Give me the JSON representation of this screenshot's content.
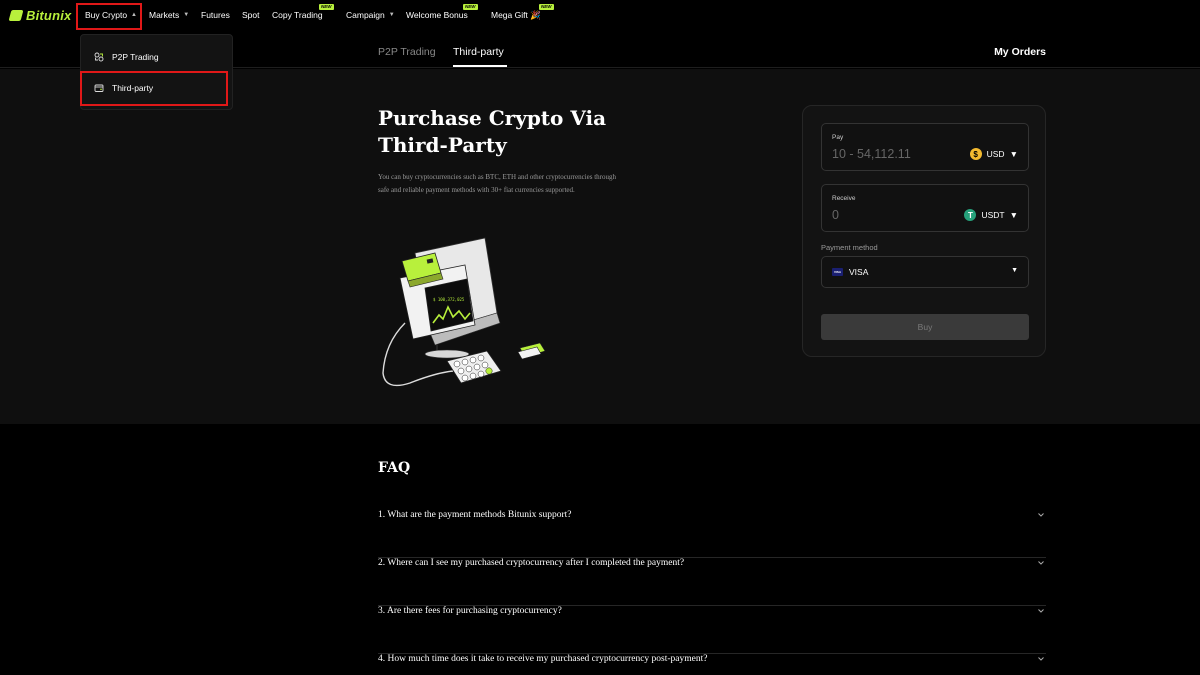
{
  "brand": {
    "name": "Bitunix",
    "accent": "#b8f03c",
    "highlight": "#e01818"
  },
  "nav": {
    "items": [
      {
        "label": "Buy Crypto",
        "caret": "▲"
      },
      {
        "label": "Markets",
        "caret": "▼"
      },
      {
        "label": "Futures"
      },
      {
        "label": "Spot"
      },
      {
        "label": "Copy Trading",
        "tag": "NEW"
      },
      {
        "label": "Campaign",
        "caret": "▼"
      },
      {
        "label": "Welcome Bonus",
        "tag": "NEW"
      },
      {
        "label": "Mega Gift 🎉",
        "tag": "NEW"
      }
    ]
  },
  "dropdown": {
    "items": [
      {
        "label": "P2P Trading",
        "icon": "p2p-icon"
      },
      {
        "label": "Third-party",
        "icon": "third-party-icon"
      }
    ]
  },
  "subtabs": {
    "items": [
      {
        "label": "P2P Trading"
      },
      {
        "label": "Third-party"
      }
    ],
    "active": "Third-party",
    "my_orders": "My Orders"
  },
  "hero": {
    "title": "Purchase Crypto Via Third-Party",
    "description": "You can buy cryptocurrencies such as BTC, ETH and other cryptocurrencies through safe and reliable payment methods with 30+ fiat currencies supported.",
    "illustration_amount": "$ 100,372,025"
  },
  "form": {
    "pay": {
      "label": "Pay",
      "placeholder": "10 - 54,112.11",
      "currency": "USD",
      "coin_icon": "usd-coin-icon",
      "coin_color": "#f3ba2f"
    },
    "receive": {
      "label": "Receive",
      "value": "0",
      "currency": "USDT",
      "coin_icon": "usdt-coin-icon",
      "coin_color": "#26a17b"
    },
    "payment_method": {
      "label": "Payment method",
      "value": "VISA",
      "badge": "VISA"
    },
    "buy_label": "Buy"
  },
  "faq": {
    "title": "FAQ",
    "items": [
      "1. What are the payment methods Bitunix support?",
      "2. Where can I see my purchased cryptocurrency after I completed the payment?",
      "3. Are there fees for purchasing cryptocurrency?",
      "4. How much time does it take to receive my purchased cryptocurrency post-payment?"
    ]
  }
}
